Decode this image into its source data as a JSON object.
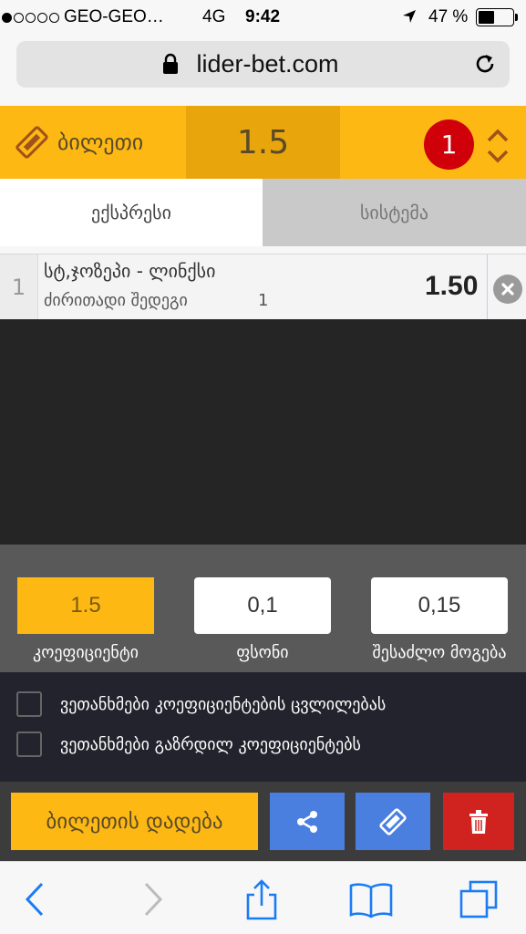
{
  "status": {
    "carrier": "GEO-GEO…",
    "network": "4G",
    "time": "9:42",
    "battery_pct": "47 %",
    "battery_level": 0.47
  },
  "browser": {
    "url": "lider-bet.com"
  },
  "bet_header": {
    "title": "ბილეთი",
    "total_odds": "1.5",
    "selection_count": "1"
  },
  "tabs": [
    {
      "label": "ექსპრესი",
      "active": true
    },
    {
      "label": "სისტემა",
      "active": false
    }
  ],
  "selections": [
    {
      "index": "1",
      "match": "სტ,ჯოზეპი - ლინქსი",
      "market": "ძირითადი შედეგი",
      "outcome": "1",
      "odds": "1.50"
    }
  ],
  "stake": {
    "odds_value": "1.5",
    "amount_value": "0,1",
    "win_value": "0,15",
    "odds_label": "კოეფიციენტი",
    "amount_label": "ფსონი",
    "win_label": "შესაძლო მოგება"
  },
  "options": [
    "ვეთანხმები კოეფიციენტების ცვლილებას",
    "ვეთანხმები გაზრდილ კოეფიციენტებს"
  ],
  "actions": {
    "place_bet": "ბილეთის დადება"
  },
  "colors": {
    "brand_yellow": "#fdb813",
    "odds_box": "#e8a60c",
    "badge_red": "#d0000a",
    "action_blue": "#4a7fe0",
    "delete_red": "#d0231f",
    "ios_blue": "#1a7cf5"
  }
}
